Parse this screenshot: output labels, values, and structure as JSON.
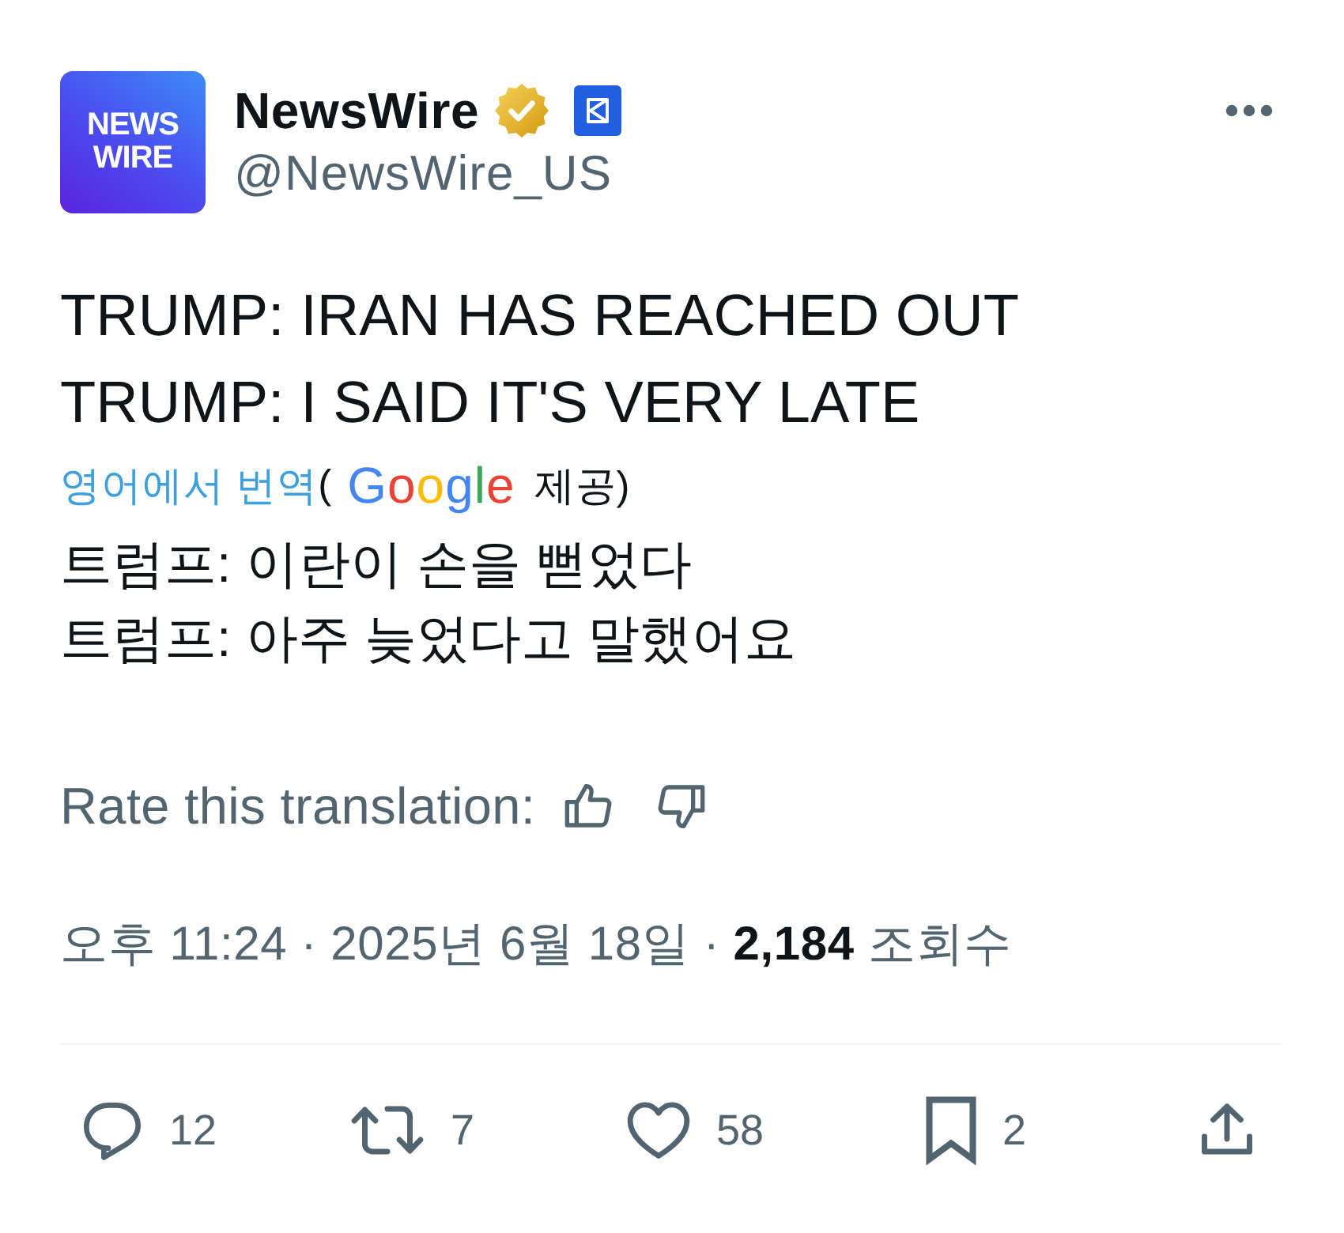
{
  "author": {
    "avatar_lines": [
      "NEWS",
      "WIRE"
    ],
    "name": "NewsWire",
    "verified": true,
    "affiliate": true,
    "handle": "@NewsWire_US"
  },
  "tweet": {
    "lines": [
      "TRUMP: IRAN HAS REACHED OUT",
      "TRUMP: I SAID IT'S VERY LATE"
    ]
  },
  "translation": {
    "link": "영어에서 번역",
    "open": "(",
    "provider": "Google",
    "credit": "제공)",
    "lines": [
      "트럼프: 이란이 손을 뻗었다",
      "트럼프: 아주 늦었다고 말했어요"
    ],
    "rate_label": "Rate this translation:"
  },
  "meta": "오후 11:24 · 2025년 6월 18일 · **2,184** 조회수",
  "actions": [
    {
      "kind": "reply",
      "count": "12"
    },
    {
      "kind": "repost",
      "count": "7"
    },
    {
      "kind": "like",
      "count": "58"
    },
    {
      "kind": "bookmark",
      "count": "2"
    },
    {
      "kind": "share"
    }
  ]
}
